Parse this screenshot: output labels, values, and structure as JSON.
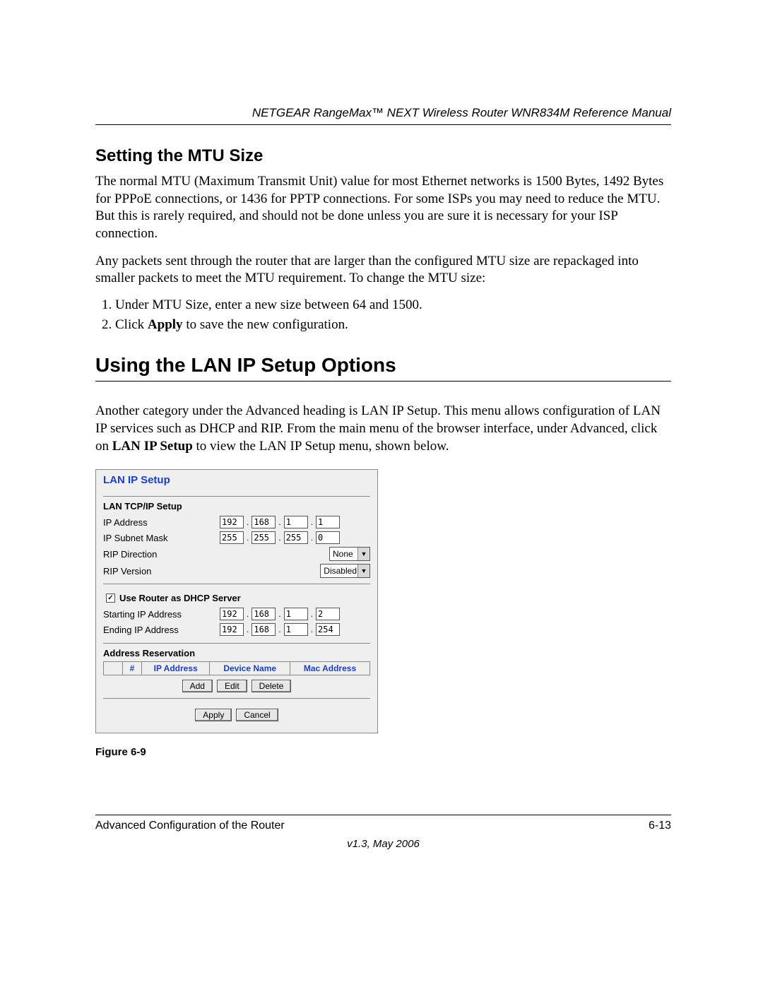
{
  "header": "NETGEAR RangeMax™ NEXT Wireless Router WNR834M Reference Manual",
  "section1": {
    "title": "Setting the MTU Size",
    "para1": "The normal MTU (Maximum Transmit Unit) value for most Ethernet networks is 1500 Bytes, 1492 Bytes for PPPoE connections, or 1436 for PPTP connections. For some ISPs you may need to reduce the MTU. But this is rarely required, and should not be done unless you are sure it is necessary for your ISP connection.",
    "para2": "Any packets sent through the router that are larger than the configured MTU size are repackaged into smaller packets to meet the MTU requirement. To change the MTU size:",
    "steps": [
      {
        "num": "1.",
        "text": "Under MTU Size, enter a new size between 64 and 1500."
      },
      {
        "num": "2.",
        "pre": "Click ",
        "bold": "Apply",
        "post": " to save the new configuration."
      }
    ]
  },
  "section2": {
    "title": "Using the LAN IP Setup Options",
    "para_pre": "Another category under the Advanced heading is LAN IP Setup. This menu allows configuration of LAN IP services such as DHCP and RIP. From the main menu of the browser interface, under Advanced, click on ",
    "para_bold": "LAN IP Setup",
    "para_post": " to view the LAN IP Setup menu, shown below."
  },
  "panel": {
    "title": "LAN IP Setup",
    "tcpip_title": "LAN TCP/IP Setup",
    "ip_label": "IP Address",
    "ip": [
      "192",
      "168",
      "1",
      "1"
    ],
    "mask_label": "IP Subnet Mask",
    "mask": [
      "255",
      "255",
      "255",
      "0"
    ],
    "rip_dir_label": "RIP Direction",
    "rip_dir_value": "None",
    "rip_ver_label": "RIP Version",
    "rip_ver_value": "Disabled",
    "dhcp_check_label": "Use Router as DHCP Server",
    "dhcp_checked": "✓",
    "start_label": "Starting IP Address",
    "start": [
      "192",
      "168",
      "1",
      "2"
    ],
    "end_label": "Ending IP Address",
    "end": [
      "192",
      "168",
      "1",
      "254"
    ],
    "res_title": "Address Reservation",
    "res_cols": {
      "c0": "#",
      "c1": "IP Address",
      "c2": "Device Name",
      "c3": "Mac Address"
    },
    "btn_add": "Add",
    "btn_edit": "Edit",
    "btn_delete": "Delete",
    "btn_apply": "Apply",
    "btn_cancel": "Cancel"
  },
  "figure_caption": "Figure 6-9",
  "footer": {
    "left": "Advanced Configuration of the Router",
    "right": "6-13",
    "version": "v1.3, May 2006"
  }
}
